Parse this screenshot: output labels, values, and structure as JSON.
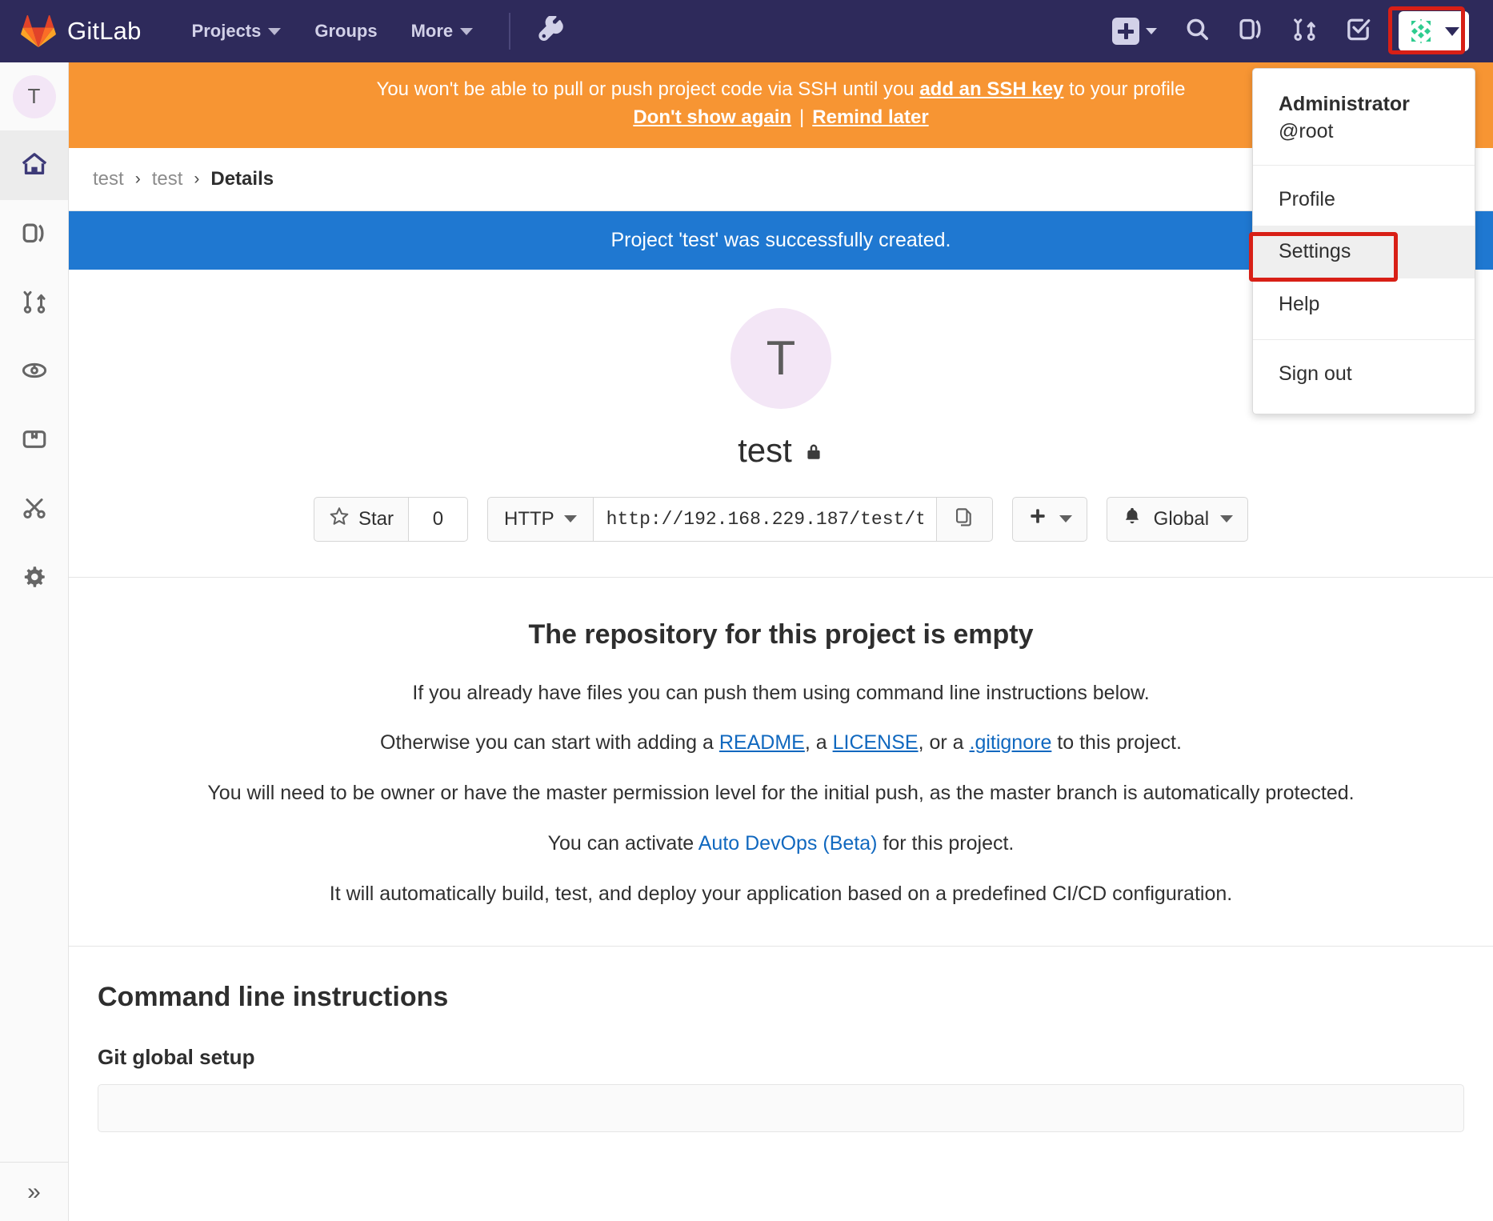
{
  "navbar": {
    "brand": "GitLab",
    "links": [
      {
        "label": "Projects",
        "caret": true,
        "icon": "chevron-down-icon"
      },
      {
        "label": "Groups",
        "caret": false,
        "icon": ""
      },
      {
        "label": "More",
        "caret": true,
        "icon": "chevron-down-icon"
      }
    ],
    "admin_icon": "wrench-icon",
    "right_icons": [
      "plus-square-icon",
      "search-icon",
      "issues-icon",
      "merge-request-icon",
      "todos-check-icon"
    ],
    "user_menu_icon": "identicon-avatar",
    "bg_color": "#2e2a5b"
  },
  "sidebar": {
    "avatar_letter": "T",
    "items": [
      {
        "name": "project-overview",
        "icon": "home-icon",
        "active": true
      },
      {
        "name": "issues",
        "icon": "issues-icon",
        "active": false
      },
      {
        "name": "merge-requests",
        "icon": "merge-request-icon",
        "active": false
      },
      {
        "name": "ci-cd",
        "icon": "rocket-icon",
        "active": false
      },
      {
        "name": "packages",
        "icon": "package-icon",
        "active": false
      },
      {
        "name": "snippets",
        "icon": "scissors-icon",
        "active": false
      },
      {
        "name": "settings",
        "icon": "gear-icon",
        "active": false
      }
    ],
    "collapse_icon": "chevron-double-right-icon",
    "collapse_glyph": "»"
  },
  "ssh_banner": {
    "text_before": "You won't be able to pull or push project code via SSH until you ",
    "link": "add an SSH key",
    "text_after": " to your profile",
    "dont_show": "Don't show again",
    "separator": "|",
    "remind": "Remind later",
    "bg_color": "#f79533"
  },
  "breadcrumb": {
    "items": [
      "test",
      "test"
    ],
    "current": "Details",
    "separator": "›"
  },
  "flash": {
    "message": "Project 'test' was successfully created.",
    "bg_color": "#1f78d1"
  },
  "project": {
    "avatar_letter": "T",
    "name": "test",
    "visibility_icon": "lock-icon",
    "star_label": "Star",
    "star_icon": "star-icon",
    "star_count": "0",
    "clone_protocol": "HTTP",
    "clone_url": "http://192.168.229.187/test/t",
    "copy_icon": "copy-icon",
    "add_icon": "plus-icon",
    "notification_icon": "bell-icon",
    "notification_label": "Global"
  },
  "empty_repo": {
    "heading": "The repository for this project is empty",
    "line1": "If you already have files you can push them using command line instructions below.",
    "line2_pre": "Otherwise you can start with adding a ",
    "readme": "README",
    "line2_mid1": ", a ",
    "license": "LICENSE",
    "line2_mid2": ", or a ",
    "gitignore": ".gitignore",
    "line2_post": " to this project.",
    "line3": "You will need to be owner or have the master permission level for the initial push, as the master branch is automatically protected.",
    "line4_pre": "You can activate ",
    "autodevops": "Auto DevOps (Beta)",
    "line4_post": " for this project.",
    "line5": "It will automatically build, test, and deploy your application based on a predefined CI/CD configuration."
  },
  "cli": {
    "heading": "Command line instructions",
    "subheading": "Git global setup"
  },
  "user_dropdown": {
    "name": "Administrator",
    "handle": "@root",
    "items": [
      {
        "label": "Profile",
        "highlighted": false
      },
      {
        "label": "Settings",
        "highlighted": true
      },
      {
        "label": "Help",
        "highlighted": false
      }
    ],
    "sign_out": "Sign out",
    "highlight_color": "#d81f16"
  }
}
